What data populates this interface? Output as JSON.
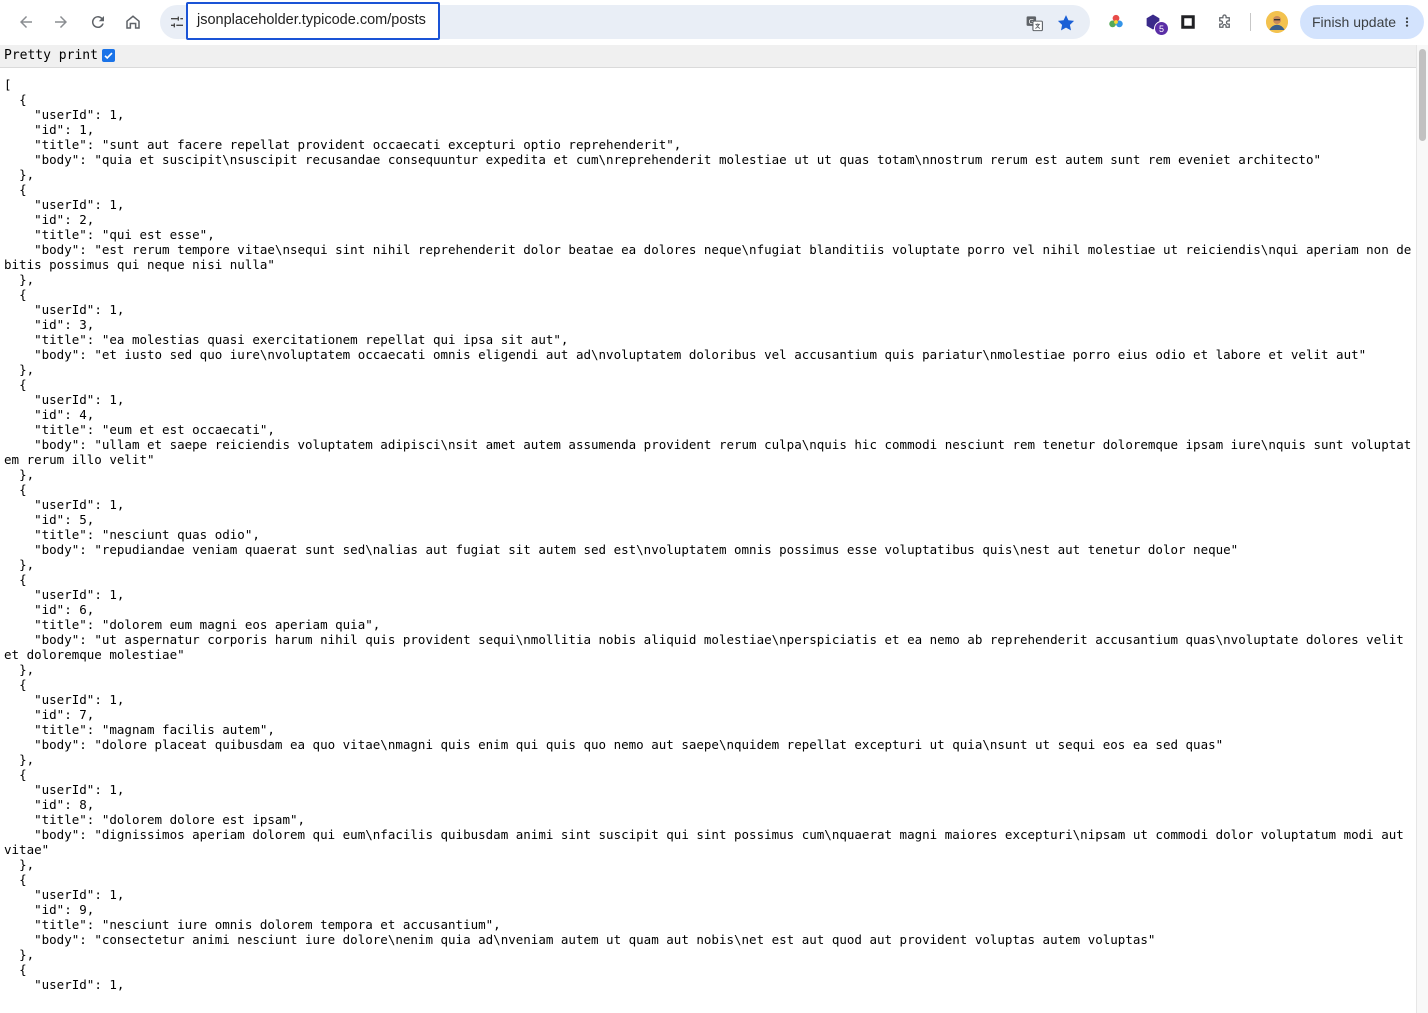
{
  "browser": {
    "url": "jsonplaceholder.typicode.com/posts",
    "update_button_label": "Finish update",
    "extension_badge": "5",
    "accent_color": "#1a53d6"
  },
  "icons": {
    "back": "back-arrow-icon",
    "forward": "forward-arrow-icon",
    "reload": "reload-icon",
    "home": "home-icon",
    "site_info": "tune-icon",
    "translate": "translate-icon",
    "bookmark": "star-icon",
    "extensions": "puzzle-icon",
    "menu": "kebab-menu-icon"
  },
  "viewer": {
    "pretty_print_label": "Pretty print",
    "pretty_print_checked": true,
    "json_text": "[\n  {\n    \"userId\": 1,\n    \"id\": 1,\n    \"title\": \"sunt aut facere repellat provident occaecati excepturi optio reprehenderit\",\n    \"body\": \"quia et suscipit\\nsuscipit recusandae consequuntur expedita et cum\\nreprehenderit molestiae ut ut quas totam\\nnostrum rerum est autem sunt rem eveniet architecto\"\n  },\n  {\n    \"userId\": 1,\n    \"id\": 2,\n    \"title\": \"qui est esse\",\n    \"body\": \"est rerum tempore vitae\\nsequi sint nihil reprehenderit dolor beatae ea dolores neque\\nfugiat blanditiis voluptate porro vel nihil molestiae ut reiciendis\\nqui aperiam non debitis possimus qui neque nisi nulla\"\n  },\n  {\n    \"userId\": 1,\n    \"id\": 3,\n    \"title\": \"ea molestias quasi exercitationem repellat qui ipsa sit aut\",\n    \"body\": \"et iusto sed quo iure\\nvoluptatem occaecati omnis eligendi aut ad\\nvoluptatem doloribus vel accusantium quis pariatur\\nmolestiae porro eius odio et labore et velit aut\"\n  },\n  {\n    \"userId\": 1,\n    \"id\": 4,\n    \"title\": \"eum et est occaecati\",\n    \"body\": \"ullam et saepe reiciendis voluptatem adipisci\\nsit amet autem assumenda provident rerum culpa\\nquis hic commodi nesciunt rem tenetur doloremque ipsam iure\\nquis sunt voluptatem rerum illo velit\"\n  },\n  {\n    \"userId\": 1,\n    \"id\": 5,\n    \"title\": \"nesciunt quas odio\",\n    \"body\": \"repudiandae veniam quaerat sunt sed\\nalias aut fugiat sit autem sed est\\nvoluptatem omnis possimus esse voluptatibus quis\\nest aut tenetur dolor neque\"\n  },\n  {\n    \"userId\": 1,\n    \"id\": 6,\n    \"title\": \"dolorem eum magni eos aperiam quia\",\n    \"body\": \"ut aspernatur corporis harum nihil quis provident sequi\\nmollitia nobis aliquid molestiae\\nperspiciatis et ea nemo ab reprehenderit accusantium quas\\nvoluptate dolores velit et doloremque molestiae\"\n  },\n  {\n    \"userId\": 1,\n    \"id\": 7,\n    \"title\": \"magnam facilis autem\",\n    \"body\": \"dolore placeat quibusdam ea quo vitae\\nmagni quis enim qui quis quo nemo aut saepe\\nquidem repellat excepturi ut quia\\nsunt ut sequi eos ea sed quas\"\n  },\n  {\n    \"userId\": 1,\n    \"id\": 8,\n    \"title\": \"dolorem dolore est ipsam\",\n    \"body\": \"dignissimos aperiam dolorem qui eum\\nfacilis quibusdam animi sint suscipit qui sint possimus cum\\nquaerat magni maiores excepturi\\nipsam ut commodi dolor voluptatum modi aut vitae\"\n  },\n  {\n    \"userId\": 1,\n    \"id\": 9,\n    \"title\": \"nesciunt iure omnis dolorem tempora et accusantium\",\n    \"body\": \"consectetur animi nesciunt iure dolore\\nenim quia ad\\nveniam autem ut quam aut nobis\\net est aut quod aut provident voluptas autem voluptas\"\n  },\n  {\n    \"userId\": 1,"
  }
}
